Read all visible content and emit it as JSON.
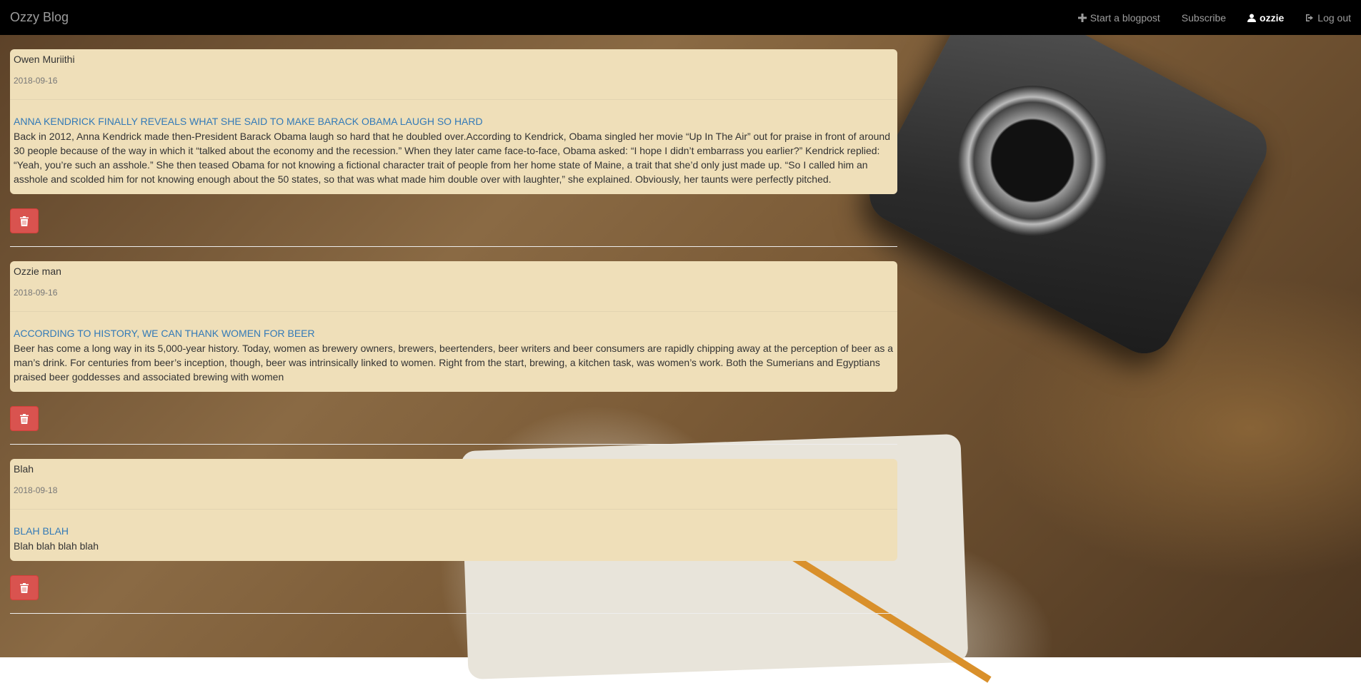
{
  "brand": "Ozzy Blog",
  "nav": {
    "start_label": "Start a blogpost",
    "subscribe_label": "Subscribe",
    "user_label": "ozzie",
    "logout_label": "Log out"
  },
  "posts": [
    {
      "author": "Owen Muriithi",
      "date": "2018-09-16",
      "title": "ANNA KENDRICK FINALLY REVEALS WHAT SHE SAID TO MAKE BARACK OBAMA LAUGH SO HARD",
      "body": "Back in 2012, Anna Kendrick made then-President Barack Obama laugh so hard that he doubled over.According to Kendrick, Obama singled her movie “Up In The Air” out for praise in front of around 30 people because of the way in which it “talked about the economy and the recession.” When they later came face-to-face, Obama asked: “I hope I didn’t embarrass you earlier?” Kendrick replied: “Yeah, you’re such an asshole.” She then teased Obama for not knowing a fictional character trait of people from her home state of Maine, a trait that she’d only just made up. “So I called him an asshole and scolded him for not knowing enough about the 50 states, so that was what made him double over with laughter,” she explained. Obviously, her taunts were perfectly pitched."
    },
    {
      "author": "Ozzie man",
      "date": "2018-09-16",
      "title": "ACCORDING TO HISTORY, WE CAN THANK WOMEN FOR BEER",
      "body": "Beer has come a long way in its 5,000-year history. Today, women as brewery owners, brewers, beertenders, beer writers and beer consumers are rapidly chipping away at the perception of beer as a man’s drink. For centuries from beer’s inception, though, beer was intrinsically linked to women. Right from the start, brewing, a kitchen task, was women’s work. Both the Sumerians and Egyptians praised beer goddesses and associated brewing with women"
    },
    {
      "author": "Blah",
      "date": "2018-09-18",
      "title": "BLAH BLAH",
      "body": "Blah blah blah blah"
    }
  ],
  "colors": {
    "card": "#efdfb9",
    "link": "#337ab7",
    "danger": "#d9534f",
    "navbar": "#000000"
  },
  "icons": {
    "start": "plus-icon",
    "user": "user-icon",
    "logout": "logout-icon",
    "delete": "trash-icon"
  }
}
